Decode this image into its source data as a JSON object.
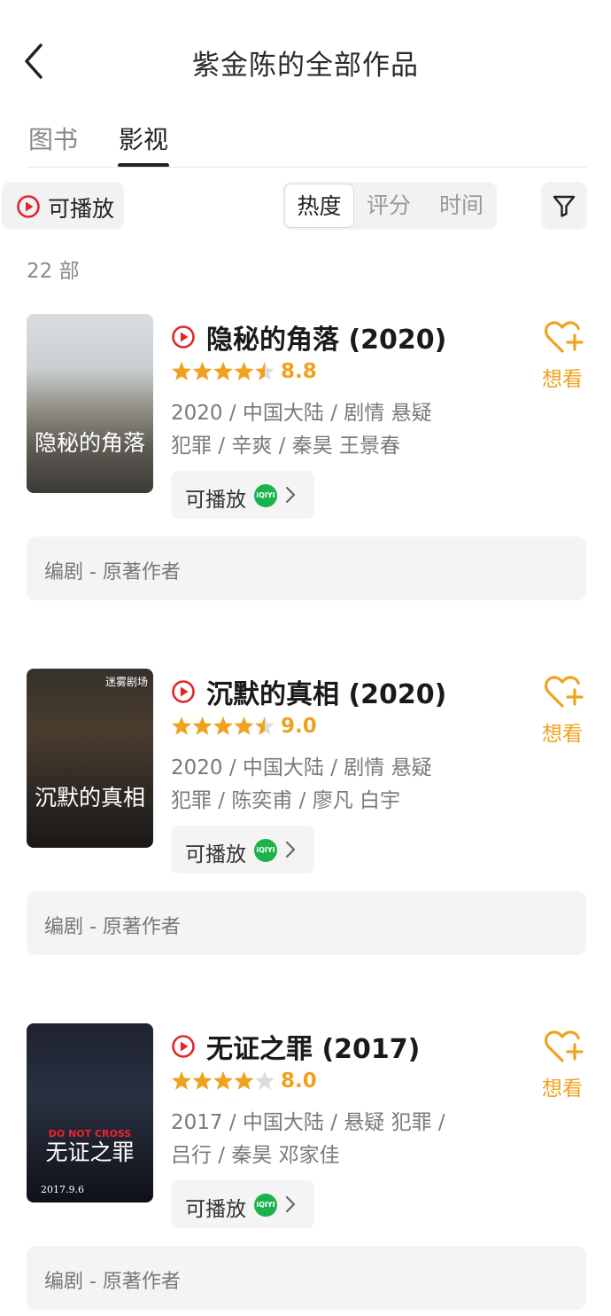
{
  "header": {
    "title": "紫金陈的全部作品",
    "back_icon": "chevron-left-icon"
  },
  "tabs": [
    {
      "label": "图书",
      "active": false
    },
    {
      "label": "影视",
      "active": true
    }
  ],
  "filters": {
    "playable_label": "可播放",
    "sort_options": [
      "热度",
      "评分",
      "时间"
    ],
    "active_sort": "热度",
    "filter_icon": "funnel-icon"
  },
  "count_label": "22 部",
  "colors": {
    "accent_orange": "#f0a21f",
    "play_red": "#e0262a",
    "iqiyi_green": "#19b34a"
  },
  "works": [
    {
      "title": "隐秘的角落 (2020)",
      "rating": "8.8",
      "stars": 4.5,
      "meta_line1": "2020 / 中国大陆 / 剧情 悬疑",
      "meta_line2": "犯罪 / 辛爽 / 秦昊 王景春",
      "play_label": "可播放",
      "platform_logo": "iQIYI",
      "want_label": "想看",
      "role": "编剧 - 原著作者",
      "poster_title": "隐秘的角落",
      "poster_top": "",
      "poster_bottom": "",
      "poster_mid": ""
    },
    {
      "title": "沉默的真相 (2020)",
      "rating": "9.0",
      "stars": 4.5,
      "meta_line1": "2020 / 中国大陆 / 剧情 悬疑",
      "meta_line2": "犯罪 / 陈奕甫 / 廖凡 白宇",
      "play_label": "可播放",
      "platform_logo": "iQIYI",
      "want_label": "想看",
      "role": "编剧 - 原著作者",
      "poster_title": "沉默的真相",
      "poster_top": "迷雾剧场",
      "poster_bottom": "",
      "poster_mid": ""
    },
    {
      "title": "无证之罪 (2017)",
      "rating": "8.0",
      "stars": 4,
      "meta_line1": "2017 / 中国大陆 / 悬疑 犯罪 /",
      "meta_line2": "吕行 / 秦昊 邓家佳",
      "play_label": "可播放",
      "platform_logo": "iQIYI",
      "want_label": "想看",
      "role": "编剧 - 原著作者",
      "poster_title": "无证之罪",
      "poster_top": "",
      "poster_bottom": "2017.9.6",
      "poster_mid": "DO NOT CROSS"
    }
  ]
}
